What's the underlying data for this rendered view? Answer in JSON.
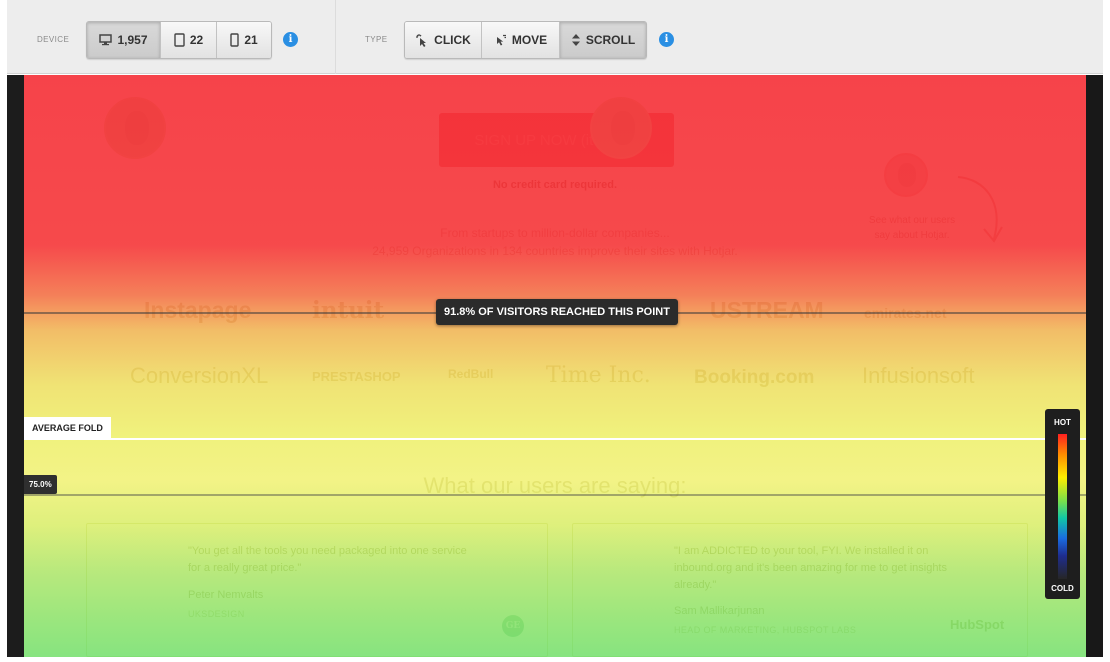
{
  "toolbar": {
    "device_label": "DEVICE",
    "devices": [
      {
        "icon": "desktop-icon",
        "count": "1,957",
        "active": true
      },
      {
        "icon": "tablet-icon",
        "count": "22",
        "active": false
      },
      {
        "icon": "phone-icon",
        "count": "21",
        "active": false
      }
    ],
    "type_label": "TYPE",
    "types": [
      {
        "icon": "click-icon",
        "label": "CLICK",
        "active": false
      },
      {
        "icon": "move-icon",
        "label": "MOVE",
        "active": false
      },
      {
        "icon": "scroll-icon",
        "label": "SCROLL",
        "active": true
      }
    ],
    "info_glyph": "i"
  },
  "page": {
    "signup_button": "SIGN UP NOW (it's free)",
    "no_credit_card": "No credit card required.",
    "tagline_line1": "From startups to million-dollar companies...",
    "tagline_line2": "24,959 Organizations in 134 countries improve their sites with Hotjar.",
    "see_users_line1": "See what our users",
    "see_users_line2": "say about Hotjar.",
    "logos_row1": [
      "Instapage",
      "intuit",
      "USTREAM",
      "emirates.net"
    ],
    "logos_row2": [
      "ConversionXL",
      "PRESTASHOP",
      "RedBull",
      "Time Inc.",
      "Booking.com",
      "Infusionsoft"
    ],
    "what_users_saying": "What our users are saying:",
    "testimonials": [
      {
        "quote_line1": "\"You get all the tools you need packaged into one service",
        "quote_line2": "for a really great price.\"",
        "name": "Peter Nemvalts",
        "company": "UKSDESIGN",
        "logo": "GE"
      },
      {
        "quote_line1": "\"I am ADDICTED to your tool, FYI. We installed it on",
        "quote_line2": "inbound.org and it's been amazing for me to get insights",
        "quote_line3": "already.\"",
        "name": "Sam Mallikarjunan",
        "company": "HEAD OF MARKETING, HUBSPOT LABS",
        "logo": "HubSpot"
      }
    ]
  },
  "heatmap": {
    "reach_label": "91.8% OF VISITORS REACHED THIS POINT",
    "average_fold_label": "AVERAGE FOLD",
    "scroll_marker": "75.0%",
    "legend_hot": "HOT",
    "legend_cold": "COLD",
    "colors": {
      "hot": "#f5333b",
      "warm": "#ecdc52",
      "cool": "#76e06e"
    }
  }
}
